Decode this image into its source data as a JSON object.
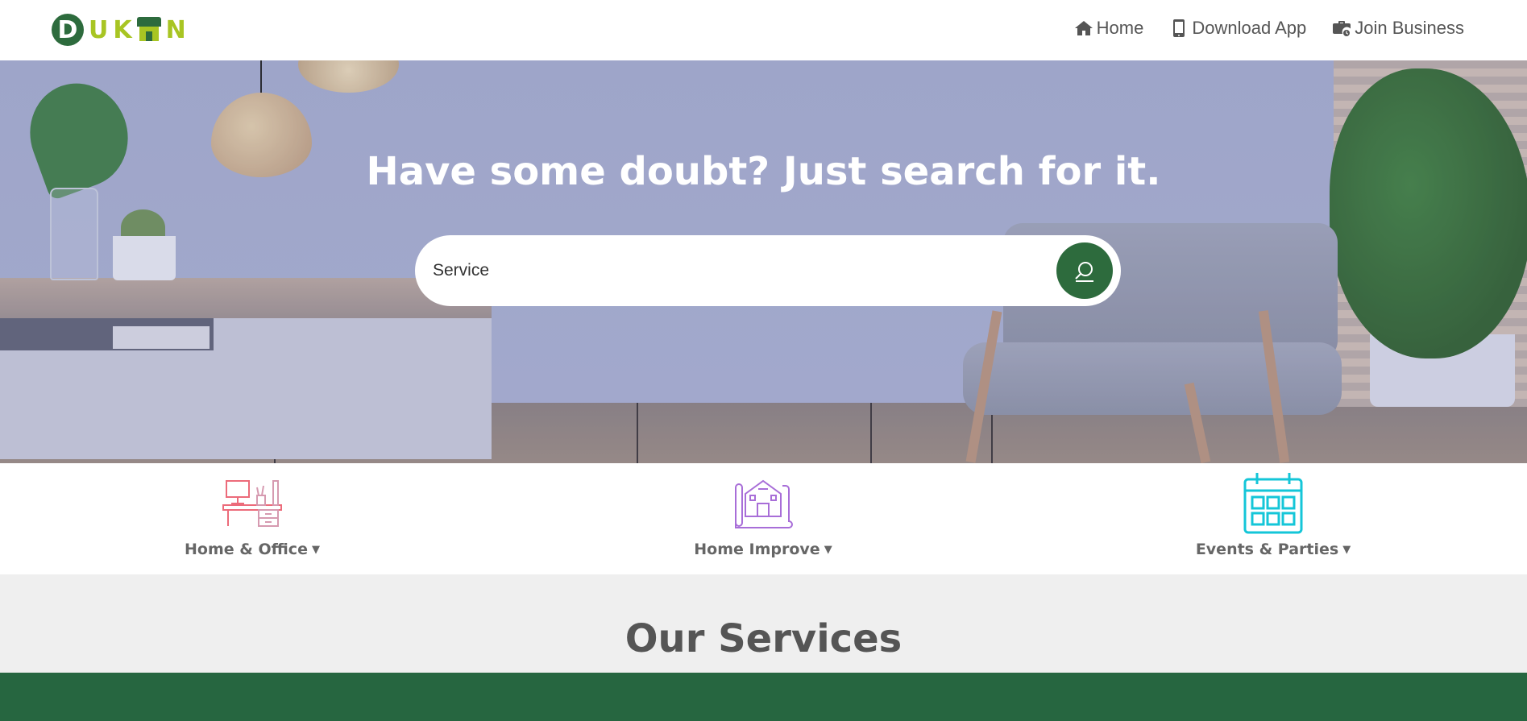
{
  "header": {
    "logo_text": "DUKAN",
    "nav": [
      {
        "label": "Home",
        "icon": "home-icon"
      },
      {
        "label": "Download App",
        "icon": "mobile-icon"
      },
      {
        "label": "Join Business",
        "icon": "briefcase-clock-icon"
      }
    ]
  },
  "hero": {
    "title": "Have some doubt? Just search for it.",
    "search": {
      "value": "Service",
      "button_icon": "search-icon"
    }
  },
  "categories": [
    {
      "label": "Home & Office",
      "icon": "desk-icon",
      "color": "#ec6b7a"
    },
    {
      "label": "Home Improve",
      "icon": "house-plan-icon",
      "color": "#a86ed8"
    },
    {
      "label": "Events & Parties",
      "icon": "calendar-icon",
      "color": "#14c6d8"
    }
  ],
  "services": {
    "title": "Our Services"
  },
  "colors": {
    "brand_green": "#2d6b3d",
    "brand_lime": "#a8c523",
    "band_green": "#266640"
  }
}
